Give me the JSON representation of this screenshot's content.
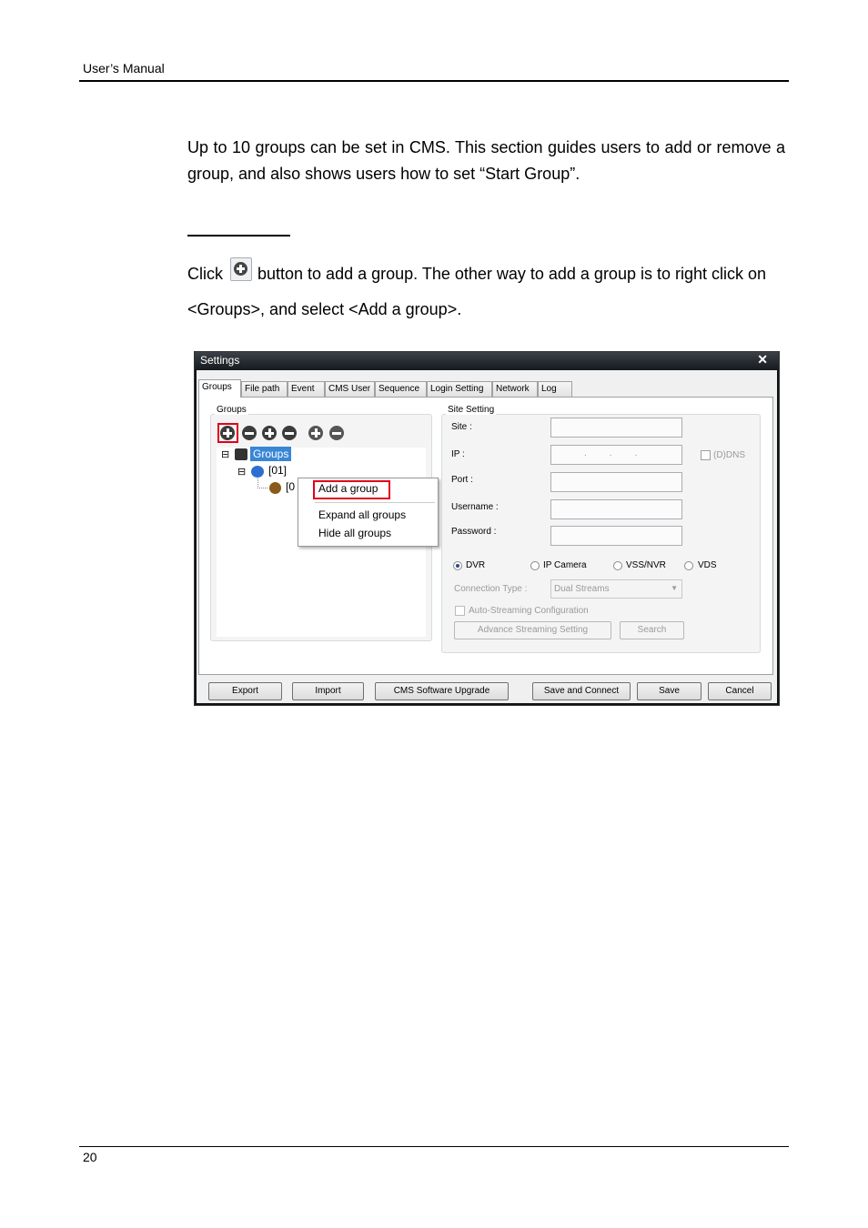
{
  "header": {
    "title": "User’s Manual"
  },
  "intro": "Up to 10 groups can be set in CMS. This section guides users to add or remove a group, and also shows users how to set “Start Group”.",
  "instruction": {
    "before_icon": "Click",
    "after_icon": "button to add a group. The other way to add a group is to right click on <Groups>, and select <Add a group>.",
    "icon": "add-group-icon"
  },
  "dialog": {
    "title": "Settings",
    "close": "✕",
    "tabs": [
      "Groups",
      "File path",
      "Event",
      "CMS User",
      "Sequence",
      "Login Setting",
      "Network",
      "Log"
    ],
    "groups_panel": {
      "label": "Groups",
      "tree": {
        "root": "Groups",
        "child": "[01]",
        "grandchild": "[0"
      }
    },
    "context_menu": {
      "items": [
        "Add a group",
        "Expand all groups",
        "Hide all groups"
      ]
    },
    "site_setting": {
      "label": "Site Setting",
      "site": "Site :",
      "ip": "IP :",
      "ip_dots": ".         .         .",
      "ddns": "(D)DNS",
      "port": "Port :",
      "username": "Username :",
      "password": "Password :",
      "device_types": [
        "DVR",
        "IP Camera",
        "VSS/NVR",
        "VDS"
      ],
      "connection_type_label": "Connection Type :",
      "connection_type_value": "Dual Streams",
      "auto_streaming": "Auto-Streaming Configuration",
      "advance_button": "Advance Streaming Setting",
      "search_button": "Search"
    },
    "buttons": [
      "Export",
      "Import",
      "CMS Software Upgrade",
      "Save and Connect",
      "Save",
      "Cancel"
    ]
  },
  "footer": {
    "page": "20"
  }
}
